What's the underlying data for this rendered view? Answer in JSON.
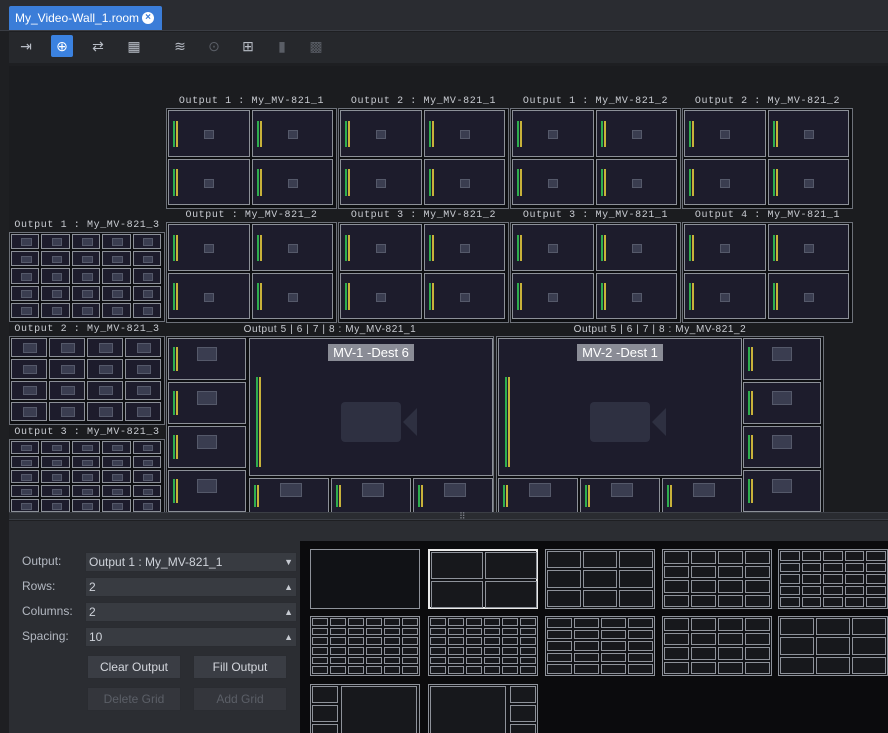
{
  "tab": {
    "title": "My_Video-Wall_1.room",
    "close_icon": "close-icon"
  },
  "toolbar": {
    "icons": [
      "exit-icon",
      "add-grid-icon",
      "swap-icon",
      "grid-select-icon",
      "layers-icon",
      "zoom-icon",
      "add-tile-icon",
      "delete-icon",
      "layout-icon"
    ],
    "active": "add-grid-icon"
  },
  "wall": {
    "outputs_row1": [
      "Output 1 : My_MV-821_1",
      "Output 2 : My_MV-821_1",
      "Output 1 : My_MV-821_2",
      "Output 2 : My_MV-821_2"
    ],
    "outputs_row2": [
      "Output : My_MV-821_2",
      "Output 3 : My_MV-821_2",
      "Output 3 : My_MV-821_1",
      "Output 4 : My_MV-821_1"
    ],
    "left_panels": [
      "Output 1 : My_MV-821_3",
      "Output 2 : My_MV-821_3",
      "Output 3 : My_MV-821_3"
    ],
    "multi": [
      {
        "title": "Output 5 | 6 | 7 | 8 : My_MV-821_1",
        "big_label": "MV-1 -Dest 6"
      },
      {
        "title": "Output 5 | 6 | 7 | 8 : My_MV-821_2",
        "big_label": "MV-2 -Dest 1"
      }
    ]
  },
  "props": {
    "output_label": "Output:",
    "output_value": "Output 1 : My_MV-821_1",
    "rows_label": "Rows:",
    "rows_value": "2",
    "columns_label": "Columns:",
    "columns_value": "2",
    "spacing_label": "Spacing:",
    "spacing_value": "10",
    "clear_output": "Clear Output",
    "fill_output": "Fill Output",
    "delete_grid": "Delete Grid",
    "add_grid": "Add Grid"
  },
  "templates": {
    "selected_index": 1,
    "count": 12
  }
}
